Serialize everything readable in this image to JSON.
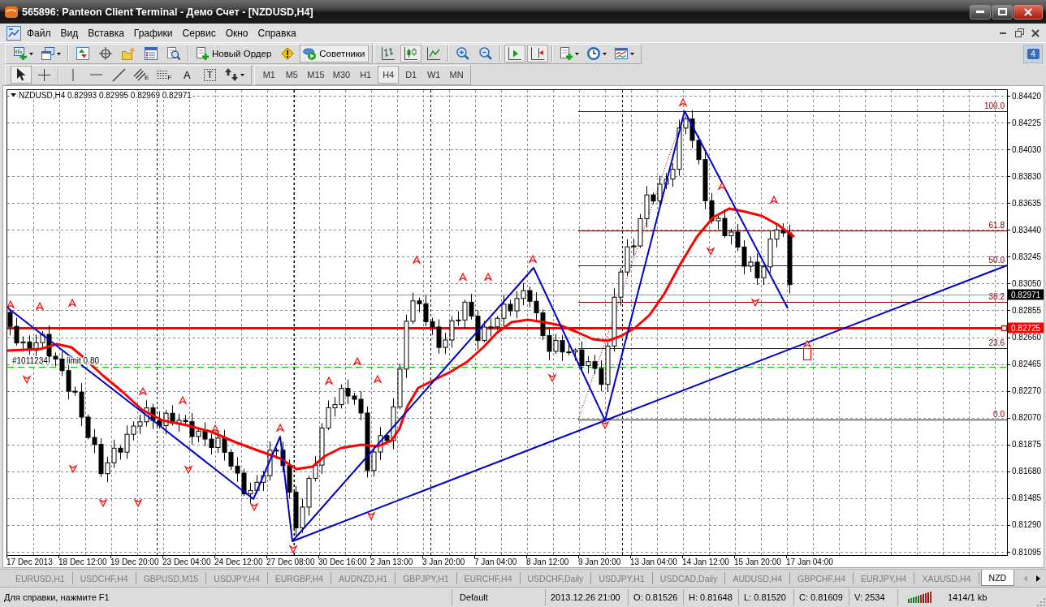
{
  "window": {
    "title": "565896: Panteon Client Terminal - Демо Счет - [NZDUSD,H4]"
  },
  "menu": [
    "Файл",
    "Вид",
    "Вставка",
    "Графики",
    "Сервис",
    "Окно",
    "Справка"
  ],
  "toolbar": {
    "groups": [
      [
        {
          "kind": "menu",
          "pressed": false
        },
        {
          "kind": "menu",
          "pressed": false
        }
      ],
      [
        {
          "kind": "button",
          "pressed": false
        },
        {
          "kind": "button",
          "pressed": false
        },
        {
          "kind": "button",
          "pressed": false
        },
        {
          "kind": "button",
          "pressed": false
        },
        {
          "kind": "button",
          "pressed": false
        }
      ],
      [
        {
          "kind": "button",
          "label": "Новый Ордер",
          "pressed": false
        },
        {
          "kind": "button",
          "pressed": false
        },
        {
          "kind": "button",
          "label": "Советники",
          "pressed": true
        }
      ],
      [
        {
          "kind": "button",
          "pressed": false
        },
        {
          "kind": "button",
          "pressed": true
        },
        {
          "kind": "button",
          "pressed": false
        }
      ],
      [
        {
          "kind": "button",
          "pressed": false
        },
        {
          "kind": "button",
          "pressed": false
        }
      ],
      [
        {
          "kind": "button",
          "pressed": true
        },
        {
          "kind": "button",
          "pressed": true
        }
      ],
      [
        {
          "kind": "menu",
          "pressed": false
        },
        {
          "kind": "menu",
          "pressed": false
        },
        {
          "kind": "menu",
          "pressed": false
        }
      ]
    ],
    "notifications": "4"
  },
  "drawing_tools": {
    "groups": [
      [
        {
          "kind": "button",
          "pressed": true
        },
        {
          "kind": "button",
          "pressed": false
        }
      ],
      [
        {
          "kind": "button",
          "pressed": false
        },
        {
          "kind": "button",
          "pressed": false
        },
        {
          "kind": "button",
          "pressed": false
        },
        {
          "kind": "button",
          "glyph": "E",
          "pressed": false
        },
        {
          "kind": "button",
          "glyph": "F",
          "pressed": false
        },
        {
          "kind": "button",
          "glyph": "A",
          "pressed": false
        },
        {
          "kind": "button",
          "glyph": "T",
          "pressed": false
        },
        {
          "kind": "menu",
          "pressed": false
        }
      ]
    ]
  },
  "timeframes": [
    {
      "label": "M1",
      "selected": false
    },
    {
      "label": "M5",
      "selected": false
    },
    {
      "label": "M15",
      "selected": false
    },
    {
      "label": "M30",
      "selected": false
    },
    {
      "label": "H1",
      "selected": false
    },
    {
      "label": "H4",
      "selected": true
    },
    {
      "label": "D1",
      "selected": false
    },
    {
      "label": "W1",
      "selected": false
    },
    {
      "label": "MN",
      "selected": false
    }
  ],
  "chart": {
    "header": "NZDUSD,H4 0.82993 0.82995 0.82969 0.82971",
    "price_axis": [
      "0.84420",
      "0.84225",
      "0.84030",
      "0.83830",
      "0.83635",
      "0.83440",
      "0.83245",
      "0.83050",
      "0.82855",
      "0.82660",
      "0.82465",
      "0.82270",
      "0.82070",
      "0.81875",
      "0.81680",
      "0.81485",
      "0.81290",
      "0.81095"
    ],
    "time_axis": [
      "17 Dec 2013",
      "18 Dec 12:00",
      "19 Dec 20:00",
      "23 Dec 04:00",
      "24 Dec 12:00",
      "27 Dec 08:00",
      "30 Dec 16:00",
      "2 Jan 13:00",
      "3 Jan 20:00",
      "7 Jan 04:00",
      "8 Jan 12:00",
      "9 Jan 20:00",
      "13 Jan 04:00",
      "14 Jan 12:00",
      "15 Jan 20:00",
      "17 Jan 04:00"
    ],
    "price_tags": [
      {
        "kind": "bid",
        "text": "0.82971"
      },
      {
        "kind": "line",
        "text": "0.82725"
      }
    ],
    "fibonacci_levels": [
      "100.0",
      "61.8",
      "50.0",
      "38.2",
      "23.6",
      "0.0"
    ],
    "order_label": [
      "#1011234",
      "limit 0.80"
    ]
  },
  "tabs": {
    "items": [
      {
        "label": "EURUSD,H1",
        "selected": false
      },
      {
        "label": "USDCHF,H4",
        "selected": false
      },
      {
        "label": "GBPUSD,M15",
        "selected": false
      },
      {
        "label": "USDJPY,H4",
        "selected": false
      },
      {
        "label": "EURGBP,H4",
        "selected": false
      },
      {
        "label": "AUDNZD,H1",
        "selected": false
      },
      {
        "label": "GBPJPY,H1",
        "selected": false
      },
      {
        "label": "EURCHF,H4",
        "selected": false
      },
      {
        "label": "USDCHF,Daily",
        "selected": false
      },
      {
        "label": "USDJPY,H1",
        "selected": false
      },
      {
        "label": "USDCAD,Daily",
        "selected": false
      },
      {
        "label": "AUDUSD,H4",
        "selected": false
      },
      {
        "label": "GBPCHF,H4",
        "selected": false
      },
      {
        "label": "EURJPY,H4",
        "selected": false
      },
      {
        "label": "XAUUSD,H4",
        "selected": false
      },
      {
        "label": "NZD",
        "selected": true
      }
    ],
    "scroll": [
      {
        "disabled": true
      },
      {
        "disabled": false
      }
    ]
  },
  "status_bar": {
    "help": "Для справки, нажмите F1",
    "profile": "Default",
    "fields": [
      "2013.12.26 21:00",
      "O: 0.81526",
      "H: 0.81648",
      "L: 0.81520",
      "C: 0.81609",
      "V: 2534"
    ],
    "traffic": "1414/1 kb"
  }
}
